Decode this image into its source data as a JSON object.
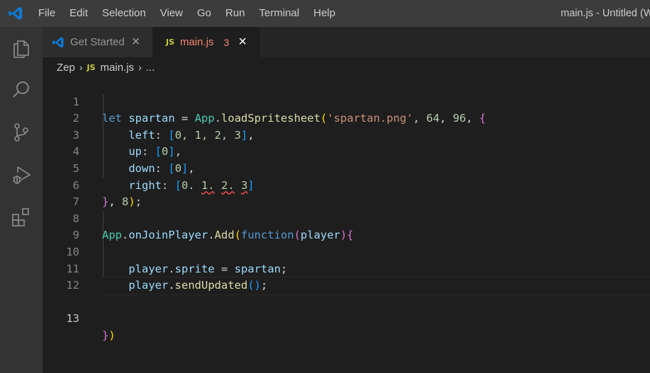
{
  "window": {
    "title": "main.js - Untitled (W",
    "menu": [
      "File",
      "Edit",
      "Selection",
      "View",
      "Go",
      "Run",
      "Terminal",
      "Help"
    ]
  },
  "activity_bar": {
    "icons": [
      "files-icon",
      "search-icon",
      "source-control-icon",
      "run-debug-icon",
      "extensions-icon"
    ]
  },
  "tabs": [
    {
      "label": "Get Started",
      "icon": "vscode-logo-icon",
      "close": "×"
    },
    {
      "label": "main.js",
      "icon": "JS",
      "problems": "3",
      "close": "×"
    }
  ],
  "breadcrumb": {
    "folder": "Zep",
    "file_icon": "JS",
    "file": "main.js",
    "more": "..."
  },
  "editor": {
    "line_numbers": [
      "1",
      "2",
      "3",
      "4",
      "5",
      "6",
      "7",
      "8",
      "9",
      "10",
      "11",
      "12",
      "13"
    ],
    "active_line": "13",
    "code": {
      "l1": {
        "kw": "let",
        "var": "spartan",
        "eq": "=",
        "obj": "App",
        "dot": ".",
        "fn": "loadSpritesheet",
        "open": "(",
        "str": "'spartan.png'",
        "c1": ",",
        "n1": "64",
        "c2": ",",
        "n2": "96",
        "c3": ",",
        "brace": "{"
      },
      "l2": {
        "key": "left",
        "colon": ":",
        "open": "[",
        "items": "0, 1, 2, 3",
        "close": "]",
        "comma": ","
      },
      "l3": {
        "key": "up",
        "colon": ":",
        "open": "[",
        "items": "0",
        "close": "]",
        "comma": ","
      },
      "l4": {
        "key": "down",
        "colon": ":",
        "open": "[",
        "items": "0",
        "close": "]",
        "comma": ","
      },
      "l5": {
        "key": "right",
        "colon": ":",
        "open": "[",
        "a": "0.",
        "b": "1.",
        "c": "2.",
        "d": "3",
        "close": "]"
      },
      "l6": {
        "brace": "}",
        "comma": ",",
        "num": "8",
        "paren": ")",
        "semi": ";"
      },
      "l8": {
        "obj": "App",
        "d1": ".",
        "p1": "onJoinPlayer",
        "d2": ".",
        "fn": "Add",
        "open": "(",
        "kw": "function",
        "popen": "(",
        "param": "player",
        "pclose": ")",
        "brace": "{"
      },
      "l10": {
        "obj": "player",
        "dot": ".",
        "prop": "sprite",
        "eq": "=",
        "val": "spartan",
        "semi": ";"
      },
      "l11": {
        "obj": "player",
        "dot": ".",
        "fn": "sendUpdated",
        "paren": "()",
        "semi": ";"
      },
      "l13": {
        "brace": "}",
        "paren": ")"
      }
    }
  },
  "colors": {
    "accent": "#0078d4",
    "keyword": "#569cd6",
    "string": "#ce9178",
    "error": "#f14c4c"
  }
}
